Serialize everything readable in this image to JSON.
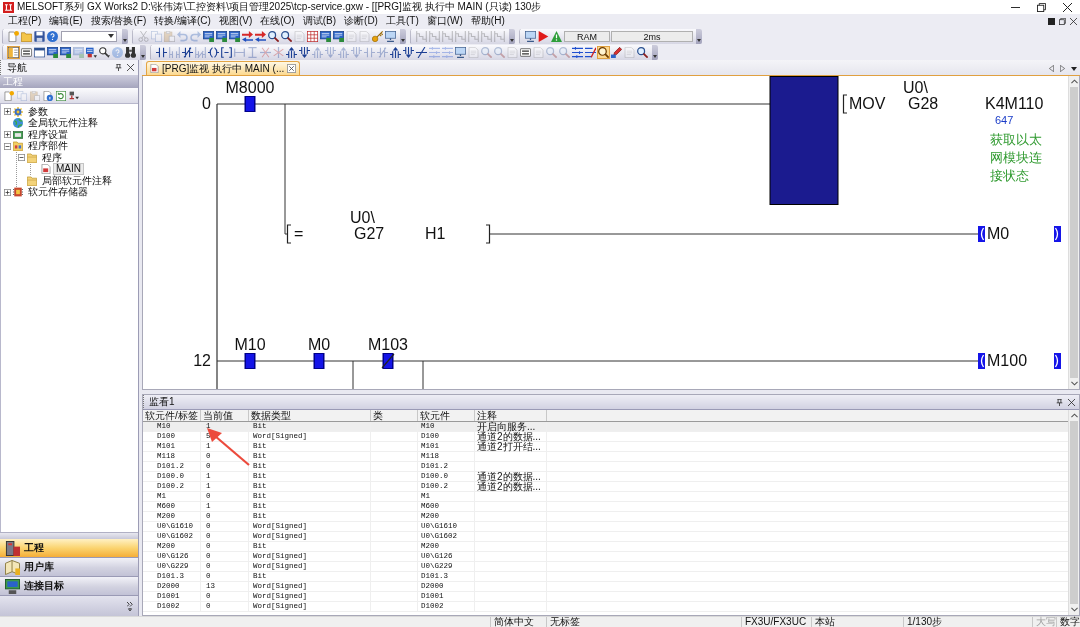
{
  "window": {
    "title": "MELSOFT系列 GX Works2 D:\\张伟涛\\工控资料\\项目管理2025\\tcp-service.gxw - [[PRG]监视 执行中 MAIN (只读) 130步"
  },
  "menu": [
    "工程(P)",
    "编辑(E)",
    "搜索/替换(F)",
    "转换/编译(C)",
    "视图(V)",
    "在线(O)",
    "调试(B)",
    "诊断(D)",
    "工具(T)",
    "窗口(W)",
    "帮助(H)"
  ],
  "toolbars": [
    {
      "groups": [
        {
          "items": [
            {
              "kind": "new-file",
              "disabled": false,
              "pressed": false
            },
            {
              "kind": "open-folder",
              "disabled": false,
              "pressed": false
            },
            {
              "kind": "save",
              "disabled": false,
              "pressed": false
            },
            {
              "kind": "help",
              "disabled": false,
              "pressed": false
            },
            {
              "kind": "combo",
              "disabled": false,
              "pressed": false
            }
          ]
        },
        {
          "items": [
            {
              "kind": "scissors",
              "disabled": true,
              "pressed": false
            },
            {
              "kind": "copy",
              "disabled": true,
              "pressed": false
            },
            {
              "kind": "paste",
              "disabled": true,
              "pressed": false
            },
            {
              "kind": "undo",
              "disabled": true,
              "pressed": false
            },
            {
              "kind": "redo",
              "disabled": true,
              "pressed": false
            },
            {
              "kind": "screen",
              "disabled": false,
              "pressed": false
            },
            {
              "kind": "screen",
              "disabled": false,
              "pressed": false
            },
            {
              "kind": "screen",
              "disabled": false,
              "pressed": false
            },
            {
              "kind": "swap",
              "disabled": false,
              "pressed": false
            },
            {
              "kind": "swap",
              "disabled": false,
              "pressed": false
            },
            {
              "kind": "search",
              "disabled": false,
              "pressed": false
            },
            {
              "kind": "search",
              "disabled": false,
              "pressed": false
            },
            {
              "kind": "doc",
              "disabled": true,
              "pressed": false
            },
            {
              "kind": "grid",
              "disabled": false,
              "pressed": false
            },
            {
              "kind": "screen",
              "disabled": false,
              "pressed": false
            },
            {
              "kind": "screen",
              "disabled": false,
              "pressed": false
            },
            {
              "kind": "doc",
              "disabled": true,
              "pressed": false
            },
            {
              "kind": "doc",
              "disabled": true,
              "pressed": false
            },
            {
              "kind": "key",
              "disabled": false,
              "pressed": false
            },
            {
              "kind": "monitor",
              "disabled": false,
              "pressed": false
            }
          ]
        },
        {
          "items": [
            {
              "kind": "steps",
              "disabled": true,
              "pressed": false
            },
            {
              "kind": "steps",
              "disabled": true,
              "pressed": false
            },
            {
              "kind": "steps",
              "disabled": true,
              "pressed": false
            },
            {
              "kind": "steps",
              "disabled": true,
              "pressed": false
            },
            {
              "kind": "steps",
              "disabled": true,
              "pressed": false
            },
            {
              "kind": "steps",
              "disabled": true,
              "pressed": false
            },
            {
              "kind": "steps",
              "disabled": true,
              "pressed": false
            }
          ]
        },
        {
          "items": [
            {
              "kind": "monitor",
              "disabled": false,
              "pressed": false
            },
            {
              "kind": "play",
              "disabled": false,
              "pressed": false
            },
            {
              "kind": "warning",
              "disabled": false,
              "pressed": false
            },
            {
              "kind": "readout",
              "text": "RAM",
              "disabled": false,
              "pressed": false
            },
            {
              "kind": "readout",
              "text": "2ms",
              "disabled": false,
              "pressed": false
            }
          ]
        }
      ]
    },
    {
      "groups": [
        {
          "items": [
            {
              "kind": "panels",
              "disabled": false,
              "pressed": true
            },
            {
              "kind": "list",
              "disabled": false,
              "pressed": false
            },
            {
              "kind": "window",
              "disabled": false,
              "pressed": false
            },
            {
              "kind": "screen",
              "disabled": false,
              "pressed": false
            },
            {
              "kind": "screen",
              "disabled": false,
              "pressed": false
            },
            {
              "kind": "screen",
              "disabled": true,
              "pressed": false
            },
            {
              "kind": "screen-menu",
              "disabled": false,
              "pressed": false
            },
            {
              "kind": "search-menu",
              "disabled": false,
              "pressed": false
            },
            {
              "kind": "help",
              "disabled": true,
              "pressed": false
            },
            {
              "kind": "binoculars",
              "disabled": false,
              "pressed": false
            }
          ]
        },
        {
          "items": [
            {
              "kind": "contact",
              "disabled": false,
              "pressed": false
            },
            {
              "kind": "contact-branch",
              "disabled": true,
              "pressed": false
            },
            {
              "kind": "contact-nc",
              "disabled": false,
              "pressed": false
            },
            {
              "kind": "contact-nc-branch",
              "disabled": true,
              "pressed": false
            },
            {
              "kind": "coil",
              "disabled": false,
              "pressed": false
            },
            {
              "kind": "instruction",
              "disabled": false,
              "pressed": false
            },
            {
              "kind": "hline",
              "disabled": true,
              "pressed": false
            },
            {
              "kind": "vline",
              "disabled": true,
              "pressed": false
            },
            {
              "kind": "hline-delete",
              "disabled": true,
              "pressed": false
            },
            {
              "kind": "vline-delete",
              "disabled": true,
              "pressed": false
            },
            {
              "kind": "rising",
              "disabled": false,
              "pressed": false
            },
            {
              "kind": "falling",
              "disabled": false,
              "pressed": false
            },
            {
              "kind": "rising",
              "disabled": true,
              "pressed": false
            },
            {
              "kind": "falling",
              "disabled": true,
              "pressed": false
            },
            {
              "kind": "rising",
              "disabled": true,
              "pressed": false
            },
            {
              "kind": "falling",
              "disabled": true,
              "pressed": false
            },
            {
              "kind": "contact",
              "disabled": true,
              "pressed": false
            },
            {
              "kind": "contact-nc",
              "disabled": true,
              "pressed": false
            },
            {
              "kind": "rising",
              "disabled": false,
              "pressed": false
            },
            {
              "kind": "falling",
              "disabled": false,
              "pressed": false
            },
            {
              "kind": "invert",
              "disabled": false,
              "pressed": false
            },
            {
              "kind": "lines",
              "disabled": true,
              "pressed": false
            },
            {
              "kind": "lines",
              "disabled": true,
              "pressed": false
            },
            {
              "kind": "monitor",
              "disabled": false,
              "pressed": false
            },
            {
              "kind": "doc",
              "disabled": true,
              "pressed": false
            },
            {
              "kind": "search",
              "disabled": true,
              "pressed": false
            },
            {
              "kind": "search",
              "disabled": true,
              "pressed": false
            },
            {
              "kind": "doc",
              "disabled": true,
              "pressed": false
            },
            {
              "kind": "list",
              "disabled": false,
              "pressed": false
            },
            {
              "kind": "doc",
              "disabled": true,
              "pressed": false
            },
            {
              "kind": "search",
              "disabled": true,
              "pressed": false
            },
            {
              "kind": "search",
              "disabled": true,
              "pressed": false
            },
            {
              "kind": "lines",
              "disabled": false,
              "pressed": false
            },
            {
              "kind": "lines-red",
              "disabled": false,
              "pressed": false
            },
            {
              "kind": "zoom",
              "disabled": false,
              "pressed": true
            },
            {
              "kind": "pen",
              "disabled": false,
              "pressed": false
            },
            {
              "kind": "doc",
              "disabled": true,
              "pressed": false
            },
            {
              "kind": "search",
              "disabled": false,
              "pressed": false
            }
          ]
        }
      ]
    }
  ],
  "navigation": {
    "title": "导航",
    "section": "工程",
    "toolbar": [
      {
        "kind": "new-file",
        "disabled": false
      },
      {
        "kind": "copy",
        "disabled": true
      },
      {
        "kind": "paste",
        "disabled": true
      },
      {
        "kind": "info",
        "disabled": false
      },
      {
        "kind": "refresh",
        "disabled": false
      },
      {
        "kind": "tool-menu",
        "disabled": false
      }
    ],
    "tree": [
      {
        "label": "参数",
        "kind": "parameter",
        "expanded": false,
        "selected": false
      },
      {
        "label": "全局软元件注释",
        "kind": "comment",
        "selected": false
      },
      {
        "label": "程序设置",
        "kind": "settings",
        "expanded": false,
        "selected": false
      },
      {
        "label": "程序部件",
        "kind": "parts",
        "expanded": true,
        "selected": false,
        "children": [
          {
            "label": "程序",
            "kind": "folder",
            "expanded": true,
            "selected": false,
            "children": [
              {
                "label": "MAIN",
                "kind": "program",
                "selected": true
              }
            ]
          },
          {
            "label": "局部软元件注释",
            "kind": "folder",
            "selected": false
          }
        ]
      },
      {
        "label": "软元件存储器",
        "kind": "memory",
        "expanded": false,
        "selected": false
      }
    ],
    "panes": [
      {
        "label": "工程",
        "kind": "project",
        "selected": true
      },
      {
        "label": "用户库",
        "kind": "library",
        "selected": false
      },
      {
        "label": "连接目标",
        "kind": "connection",
        "selected": false
      }
    ]
  },
  "editor": {
    "tabs": [
      {
        "label": "[PRG]监视 执行中 MAIN (...",
        "selected": true
      }
    ],
    "ladder": {
      "rungs": [
        {
          "step": "0",
          "continues_below": false,
          "lines": [
            {
              "contacts": [
                {
                  "kind": "open",
                  "device": "M8000",
                  "on": true
                }
              ],
              "output": {
                "kind": "instruction",
                "on": true,
                "op": "MOV",
                "source_prefix": "U0\\",
                "source": "G28",
                "dest": "K4M110",
                "dest_value": "647",
                "comment": "获取以太网模块连接状态"
              }
            },
            {
              "contacts": [
                {
                  "kind": "compare",
                  "op": "=",
                  "left_prefix": "U0\\",
                  "left": "G27",
                  "right": "H1"
                }
              ],
              "output": {
                "kind": "coil",
                "on": true,
                "device": "M0"
              }
            }
          ]
        },
        {
          "step": "12",
          "continues_below": true,
          "lines": [
            {
              "contacts": [
                {
                  "kind": "open",
                  "device": "M10",
                  "on": true
                },
                {
                  "kind": "open",
                  "device": "M0",
                  "on": true
                },
                {
                  "kind": "closed",
                  "device": "M103",
                  "on": true
                }
              ],
              "output": {
                "kind": "coil",
                "on": true,
                "device": "M100"
              }
            }
          ]
        }
      ]
    }
  },
  "watch": {
    "title": "监看1",
    "columns": [
      "软元件/标签",
      "当前值",
      "数据类型",
      "类",
      "软元件",
      "注释"
    ],
    "rows": [
      {
        "label": "M10",
        "value": "1",
        "data_type": "Bit",
        "device": "M10",
        "comment": "开启向服务...",
        "selected": true
      },
      {
        "label": "D100",
        "value": "5",
        "data_type": "Word[Signed]",
        "device": "D100",
        "comment": "通道2的数据...",
        "selected": false
      },
      {
        "label": "M101",
        "value": "1",
        "data_type": "Bit",
        "device": "M101",
        "comment": "通道2打开结...",
        "selected": false
      },
      {
        "label": "M118",
        "value": "0",
        "data_type": "Bit",
        "device": "M118",
        "selected": false
      },
      {
        "label": "D101.2",
        "value": "0",
        "data_type": "Bit",
        "device": "D101.2",
        "selected": false
      },
      {
        "label": "D100.0",
        "value": "1",
        "data_type": "Bit",
        "device": "D100.0",
        "comment": "通道2的数据...",
        "selected": false
      },
      {
        "label": "D100.2",
        "value": "1",
        "data_type": "Bit",
        "device": "D100.2",
        "comment": "通道2的数据...",
        "selected": false
      },
      {
        "label": "M1",
        "value": "0",
        "data_type": "Bit",
        "device": "M1",
        "selected": false
      },
      {
        "label": "M600",
        "value": "1",
        "data_type": "Bit",
        "device": "M600",
        "selected": false
      },
      {
        "label": "M200",
        "value": "0",
        "data_type": "Bit",
        "device": "M200",
        "selected": false
      },
      {
        "label": "U0\\G1610",
        "value": "0",
        "data_type": "Word[Signed]",
        "device": "U0\\G1610",
        "selected": false
      },
      {
        "label": "U0\\G1602",
        "value": "0",
        "data_type": "Word[Signed]",
        "device": "U0\\G1602",
        "selected": false
      },
      {
        "label": "M200",
        "value": "0",
        "data_type": "Bit",
        "device": "M200",
        "selected": false
      },
      {
        "label": "U0\\G126",
        "value": "0",
        "data_type": "Word[Signed]",
        "device": "U0\\G126",
        "selected": false
      },
      {
        "label": "U0\\G229",
        "value": "0",
        "data_type": "Word[Signed]",
        "device": "U0\\G229",
        "selected": false
      },
      {
        "label": "D101.3",
        "value": "0",
        "data_type": "Bit",
        "device": "D101.3",
        "selected": false
      },
      {
        "label": "D2000",
        "value": "13",
        "data_type": "Word[Signed]",
        "device": "D2000",
        "selected": false
      },
      {
        "label": "D1001",
        "value": "0",
        "data_type": "Word[Signed]",
        "device": "D1001",
        "selected": false
      },
      {
        "label": "D1002",
        "value": "0",
        "data_type": "Word[Signed]",
        "device": "D1002",
        "selected": false
      }
    ]
  },
  "status_bar": {
    "fields": [
      "简体中文",
      "无标签",
      "FX3U/FX3UC",
      "本站",
      "1/130步"
    ],
    "indicators": [
      {
        "label": "大写",
        "on": false
      },
      {
        "label": "数字",
        "on": true
      }
    ]
  }
}
